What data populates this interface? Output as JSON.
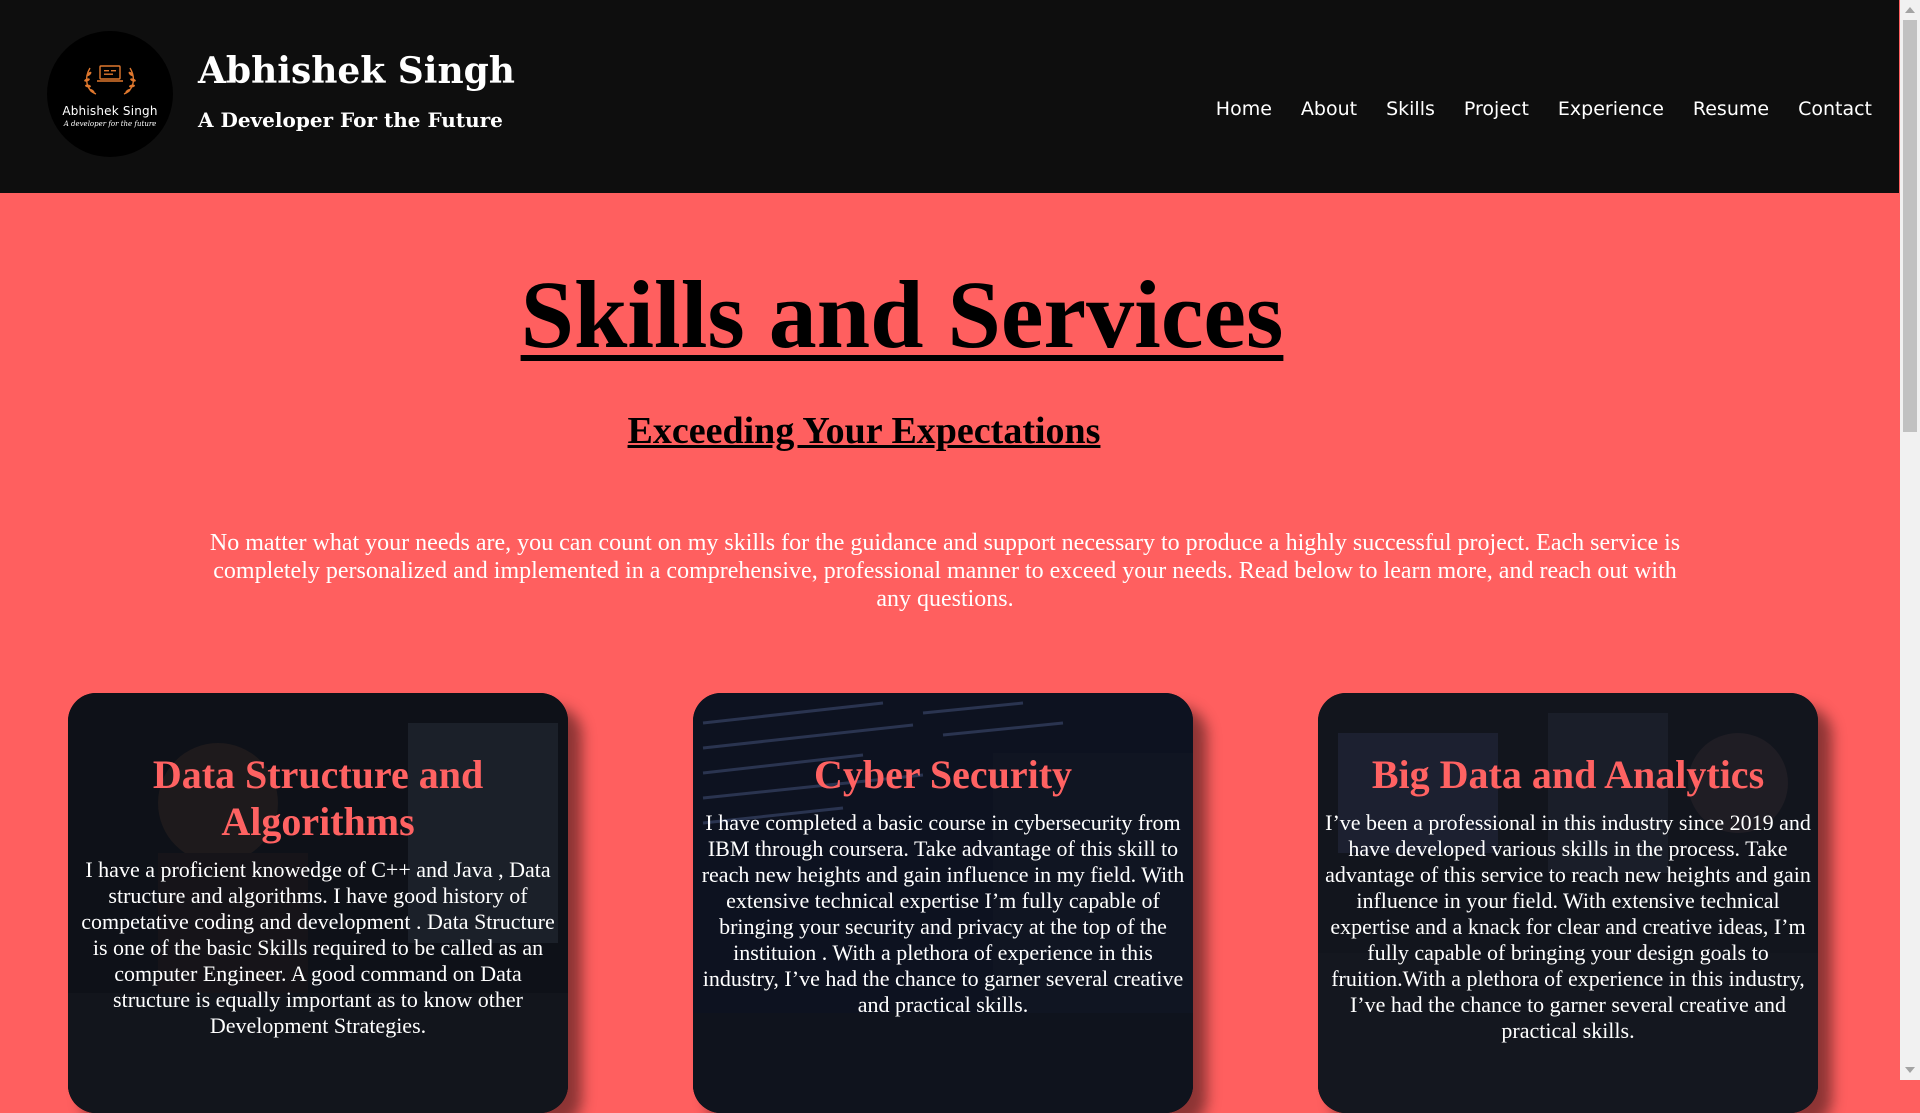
{
  "header": {
    "logo": {
      "name": "Abhishek Singh",
      "tagline": "A developer for the future",
      "icon": "laptop-laurel-icon"
    },
    "site_name": "Abhishek Singh",
    "site_tagline": "A Developer For the Future",
    "nav": [
      {
        "label": "Home"
      },
      {
        "label": "About"
      },
      {
        "label": "Skills"
      },
      {
        "label": "Project"
      },
      {
        "label": "Experience"
      },
      {
        "label": "Resume"
      },
      {
        "label": "Contact"
      }
    ]
  },
  "main": {
    "title": "Skills and Services",
    "subtitle": "Exceeding Your Expectations",
    "intro": "No matter what your needs are, you can count on my skills for the guidance and support necessary to produce a highly successful project. Each service is completely personalized and implemented in a comprehensive, professional manner to exceed your needs. Read below to learn more, and reach out with any questions.",
    "cards": [
      {
        "title": "Data Structure and Algorithms",
        "text": "I have a proficient knowedge of C++ and Java , Data structure and algorithms. I have good history of competative coding and development . Data Structure is one of the basic Skills required to be called as an computer Engineer. A good command on Data structure is equally important as to know other Development Strategies."
      },
      {
        "title": "Cyber Security",
        "text": "I have completed a basic course in cybersecurity from IBM through coursera. Take advantage of this skill to reach new heights and gain influence in my field. With extensive technical expertise I’m fully capable of bringing your security and privacy at the top of the instituion . With a plethora of experience in this industry, I’ve had the chance to garner several creative and practical skills."
      },
      {
        "title": "Big Data and Analytics",
        "text": "I’ve been a professional in this industry since 2019 and have developed various skills in the process. Take advantage of this service to reach new heights and gain influence in your field. With extensive technical expertise and a knack for clear and creative ideas, I’m fully capable of bringing your design goals to fruition.With a plethora of experience in this industry, I’ve had the chance to garner several creative and practical skills."
      }
    ]
  },
  "colors": {
    "header_bg": "#0e0e0e",
    "page_bg": "#ff5f5f",
    "card_title": "#ff6262",
    "card_bg": "#0c0e15"
  }
}
